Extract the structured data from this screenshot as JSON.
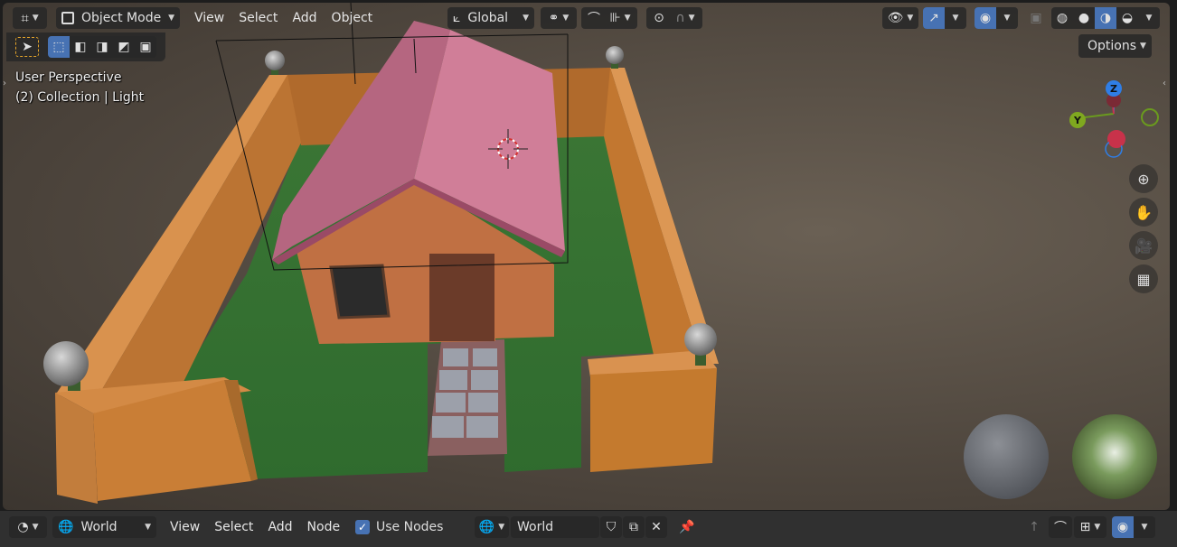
{
  "header": {
    "editor_type_icon": "viewport-editor-icon",
    "mode": "Object Mode",
    "menus": [
      "View",
      "Select",
      "Add",
      "Object"
    ],
    "transform_orientation": "Global",
    "options_label": "Options"
  },
  "overlay": {
    "view_name": "User Perspective",
    "collection_info": "(2) Collection | Light"
  },
  "gizmo": {
    "z_label": "Z",
    "y_label": "Y",
    "x_color": "#c8324a",
    "y_color": "#6a9a1e",
    "z_color": "#2f7ee6"
  },
  "footer": {
    "shader_type": "World",
    "menus": [
      "View",
      "Select",
      "Add",
      "Node"
    ],
    "use_nodes_label": "Use Nodes",
    "use_nodes_checked": true,
    "world_name": "World"
  },
  "colors": {
    "accent": "#4772b3",
    "roof": "#c77390",
    "wall": "#d38a45",
    "grass": "#3f7a35"
  }
}
